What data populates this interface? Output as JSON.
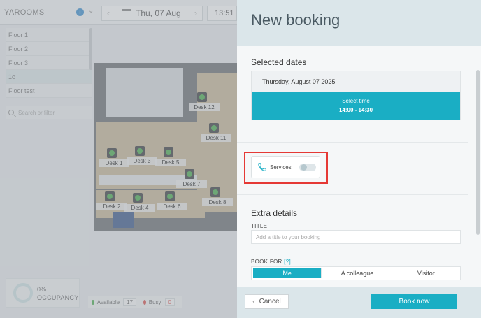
{
  "topbar": {
    "site_name": "YAROOMS",
    "info_icon": "info-icon",
    "date": "Thu, 07 Aug",
    "time": "13:51"
  },
  "floors": [
    {
      "label": "Floor 1",
      "active": false
    },
    {
      "label": "Floor 2",
      "active": false
    },
    {
      "label": "Floor 3",
      "active": false
    },
    {
      "label": "1c",
      "active": true
    },
    {
      "label": "Floor test",
      "active": false
    }
  ],
  "search": {
    "placeholder": "Search or filter"
  },
  "desks": [
    "Desk 12",
    "Desk 11",
    "Desk 1",
    "Desk 3",
    "Desk 5",
    "Desk 7",
    "Desk 8",
    "Desk 2",
    "Desk 4",
    "Desk 6"
  ],
  "occupancy": {
    "percent": "0%",
    "label": "OCCUPANCY"
  },
  "legend": {
    "available_label": "Available",
    "available_count": "17",
    "busy_label": "Busy",
    "busy_count": "0",
    "available_color": "#4caf50",
    "busy_color": "#d9534f"
  },
  "panel": {
    "title": "New booking",
    "selected_dates_title": "Selected dates",
    "date_full": "Thursday, August 07 2025",
    "select_time_label": "Select time",
    "time_range": "14:00 - 14:30",
    "services_label": "Services",
    "services_enabled": false,
    "extra_details_title": "Extra details",
    "title_label": "TITLE",
    "title_placeholder": "Add a title to your booking",
    "book_for_label": "BOOK FOR",
    "book_for_help": "[?]",
    "book_for_options": [
      "Me",
      "A colleague",
      "Visitor"
    ],
    "book_for_selected": "Me",
    "accent_color": "#1aaec4"
  },
  "footer": {
    "cancel_label": "Cancel",
    "book_label": "Book now"
  }
}
